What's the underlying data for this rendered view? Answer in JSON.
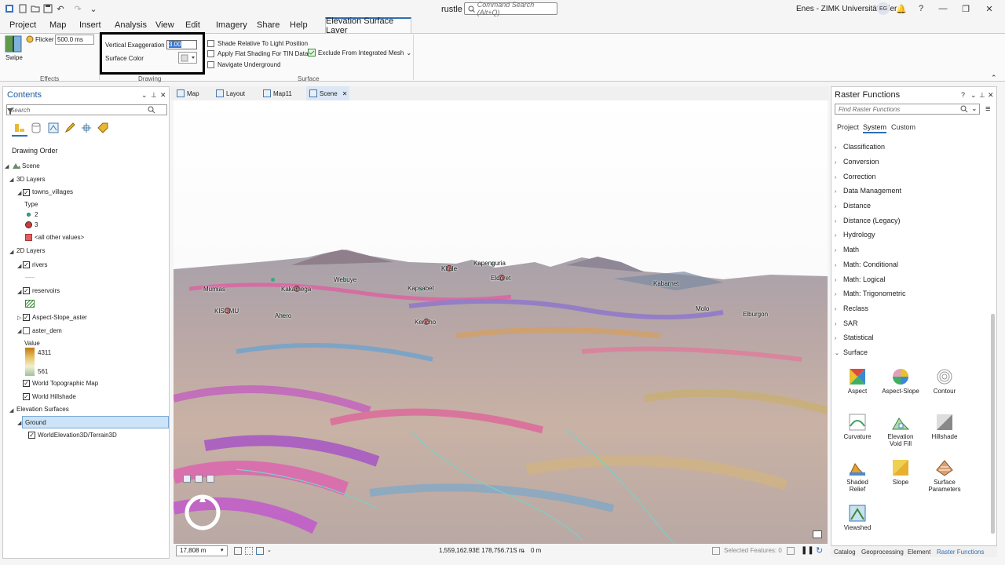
{
  "app": {
    "title": "rustle",
    "command_search_placeholder": "Command Search (Alt+Q)",
    "user": "Enes - ZIMK Universität Trier",
    "avatar_initials": "EG"
  },
  "menu": {
    "tabs": [
      "Project",
      "Map",
      "Insert",
      "Analysis",
      "View",
      "Edit",
      "Imagery",
      "Share",
      "Help"
    ],
    "active_tab": "Elevation Surface Layer"
  },
  "ribbon": {
    "swipe_label": "Swipe",
    "flicker_label": "Flicker",
    "flicker_value": "500.0  ms",
    "effects_label": "Effects",
    "vertical_exaggeration_label": "Vertical Exaggeration",
    "vertical_exaggeration_value": "3.00",
    "surface_color_label": "Surface Color",
    "drawing_label": "Drawing",
    "shade_relative": "Shade Relative To Light Position",
    "flat_shading": "Apply Flat Shading For TIN Data",
    "navigate_underground": "Navigate Underground",
    "exclude_mesh": "Exclude From Integrated Mesh",
    "surface_label": "Surface"
  },
  "contents": {
    "title": "Contents",
    "search_placeholder": "Search",
    "drawing_order": "Drawing Order",
    "scene": "Scene",
    "layers_3d": "3D Layers",
    "towns_villages": "towns_villages",
    "type_label": "Type",
    "type_2": "2",
    "type_3": "3",
    "type_other": "<all other values>",
    "layers_2d": "2D Layers",
    "rivers": "rivers",
    "reservoirs": "reservoirs",
    "aspect_slope": "Aspect-Slope_aster",
    "aster_dem": "aster_dem",
    "value_label": "Value",
    "value_high": "4311",
    "value_low": "561",
    "world_topo": "World Topographic Map",
    "world_hillshade": "World Hillshade",
    "elevation_surfaces": "Elevation Surfaces",
    "ground": "Ground",
    "terrain": "WorldElevation3D/Terrain3D"
  },
  "view_tabs": [
    "Map",
    "Layout",
    "Map11",
    "Scene"
  ],
  "scene": {
    "towns": {
      "kapenguria": "Kapenguria",
      "kitale": "Kitale",
      "eldoret": "Eldoret",
      "webuye": "Webuye",
      "mumias": "Mumias",
      "kakamega": "Kakamega",
      "kapsabet": "Kapsabet",
      "kabarnet": "Kabarnet",
      "kisumu": "KISUMU",
      "ahero": "Ahero",
      "kericho": "Kericho",
      "molo": "Molo",
      "eldurgon": "Elburgon"
    }
  },
  "status": {
    "scale": "17,808 m",
    "coordinates": "1,559,162.93E 178,756.71S m",
    "elevation": "0 m",
    "selected_features": "Selected Features: 0"
  },
  "raster": {
    "title": "Raster Functions",
    "search_placeholder": "Find Raster Functions",
    "tabs": [
      "Project",
      "System",
      "Custom"
    ],
    "active_tab": "System",
    "categories": [
      "Classification",
      "Conversion",
      "Correction",
      "Data Management",
      "Distance",
      "Distance (Legacy)",
      "Hydrology",
      "Math",
      "Math: Conditional",
      "Math: Logical",
      "Math: Trigonometric",
      "Reclass",
      "SAR",
      "Statistical",
      "Surface"
    ],
    "functions": {
      "aspect": "Aspect",
      "aspect_slope": "Aspect-Slope",
      "contour": "Contour",
      "curvature": "Curvature",
      "elevation_void_fill_1": "Elevation",
      "elevation_void_fill_2": "Void Fill",
      "hillshade": "Hillshade",
      "shaded_relief_1": "Shaded",
      "shaded_relief_2": "Relief",
      "slope": "Slope",
      "surface_parameters_1": "Surface",
      "surface_parameters_2": "Parameters",
      "viewshed": "Viewshed"
    }
  },
  "bottom_tabs": [
    "Catalog",
    "Geoprocessing",
    "Element",
    "Raster Functions"
  ]
}
